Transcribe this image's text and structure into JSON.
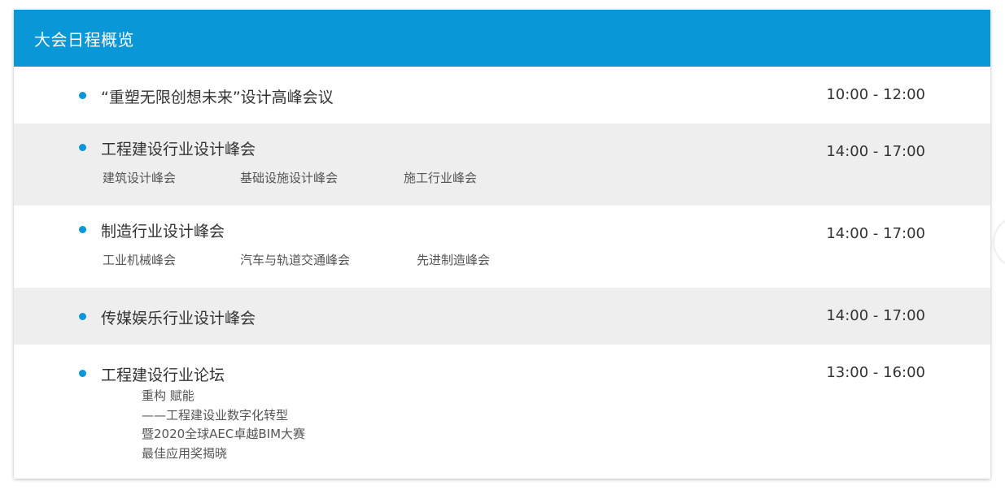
{
  "header": {
    "title": "大会日程概览"
  },
  "schedule": [
    {
      "title": "“重塑无限创想未来”设计高峰会议",
      "time": "10:00 - 12:00"
    },
    {
      "title": "工程建设行业设计峰会",
      "time": "14:00 - 17:00",
      "subsessions": [
        "建筑设计峰会",
        "基础设施设计峰会",
        "施工行业峰会"
      ]
    },
    {
      "title": "制造行业设计峰会",
      "time": "14:00 - 17:00",
      "subsessions": [
        "工业机械峰会",
        "汽车与轨道交通峰会",
        "先进制造峰会"
      ]
    },
    {
      "title": "传媒娱乐行业设计峰会",
      "time": "14:00 - 17:00"
    },
    {
      "title": "工程建设行业论坛",
      "time": "13:00 - 16:00",
      "description": [
        "重构 赋能",
        "——工程建设业数字化转型",
        "暨2020全球AEC卓越BIM大赛",
        "最佳应用奖揭晓"
      ]
    }
  ],
  "colors": {
    "accent": "#0997d8",
    "alt_row": "#eeeeee"
  },
  "icons": {
    "bullet": "bullet-dot-icon"
  }
}
